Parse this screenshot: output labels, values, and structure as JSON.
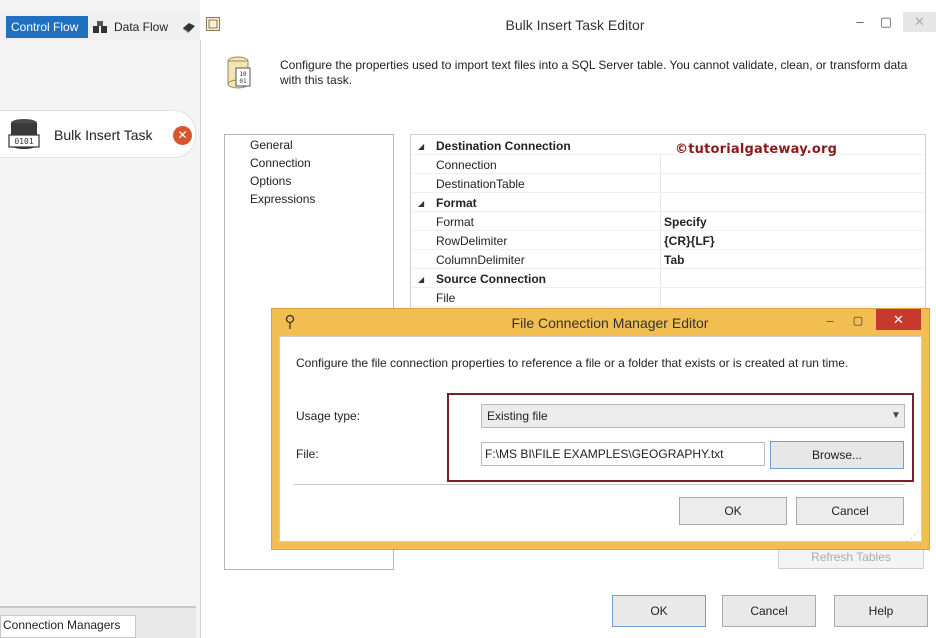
{
  "designer": {
    "tabs": [
      {
        "label": "Control Flow",
        "active": true
      },
      {
        "label": "Data Flow",
        "active": false
      }
    ],
    "task_label": "Bulk Insert Task",
    "connection_managers_tab": "Connection Managers"
  },
  "editor": {
    "title": "Bulk Insert Task Editor",
    "description": "Configure the properties used to import text files into a SQL Server table. You cannot validate, clean, or transform data with this task.",
    "nav_items": [
      "General",
      "Connection",
      "Options",
      "Expressions"
    ],
    "grid": {
      "categories": [
        {
          "label": "Destination Connection",
          "properties": [
            {
              "name": "Connection",
              "value": ""
            },
            {
              "name": "DestinationTable",
              "value": ""
            }
          ]
        },
        {
          "label": "Format",
          "properties": [
            {
              "name": "Format",
              "value": "Specify"
            },
            {
              "name": "RowDelimiter",
              "value": "{CR}{LF}"
            },
            {
              "name": "ColumnDelimiter",
              "value": "Tab"
            }
          ]
        },
        {
          "label": "Source Connection",
          "properties": [
            {
              "name": "File",
              "value": ""
            }
          ]
        }
      ]
    },
    "watermark": "©tutorialgateway.org",
    "refresh_label": "Refresh Tables",
    "buttons": {
      "ok": "OK",
      "cancel": "Cancel",
      "help": "Help"
    }
  },
  "file_connection_dialog": {
    "title": "File Connection Manager Editor",
    "description": "Configure the file connection properties to reference a file or a folder that exists or is created at run time.",
    "usage_type_label": "Usage type:",
    "usage_type_value": "Existing file",
    "file_label": "File:",
    "file_value": "F:\\MS BI\\FILE EXAMPLES\\GEOGRAPHY.txt",
    "browse_label": "Browse...",
    "ok_label": "OK",
    "cancel_label": "Cancel"
  },
  "colors": {
    "active_tab": "#1f70c1",
    "dialog_border": "#f2be52",
    "highlight_box": "#7b1d2b",
    "close_button": "#c7392c",
    "watermark": "#8b1a1a"
  }
}
